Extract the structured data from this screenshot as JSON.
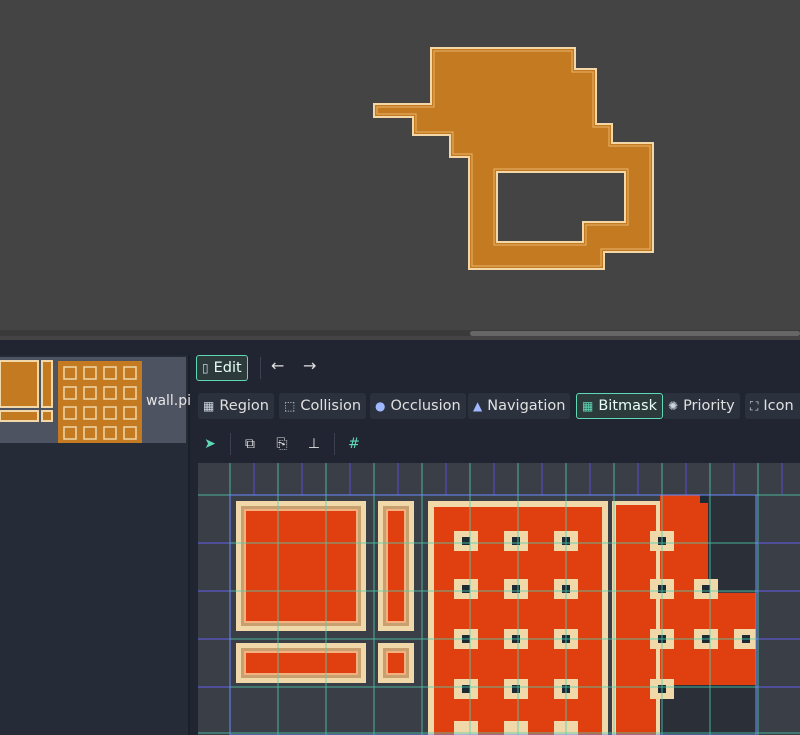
{
  "toolbar": {
    "edit_label": "Edit",
    "back_arrow": "←",
    "forward_arrow": "→"
  },
  "tile_list": {
    "item_label": "wall.pi"
  },
  "tabs": [
    {
      "label": "Region",
      "icon": "region-icon"
    },
    {
      "label": "Collision",
      "icon": "collision-icon"
    },
    {
      "label": "Occlusion",
      "icon": "occlusion-icon"
    },
    {
      "label": "Navigation",
      "icon": "navigation-icon"
    },
    {
      "label": "Bitmask",
      "icon": "bitmask-icon",
      "active": true
    },
    {
      "label": "Priority",
      "icon": "priority-icon"
    },
    {
      "label": "Icon",
      "icon": "icon-icon"
    }
  ],
  "tools": [
    "select-icon",
    "copy-icon",
    "paste-icon",
    "erase-icon",
    "snap-grid-icon"
  ],
  "colors": {
    "accent": "#5fd9b5",
    "tile_orange": "#c47a21",
    "tile_red": "#e04010",
    "tile_cream": "#f0d8a8"
  }
}
